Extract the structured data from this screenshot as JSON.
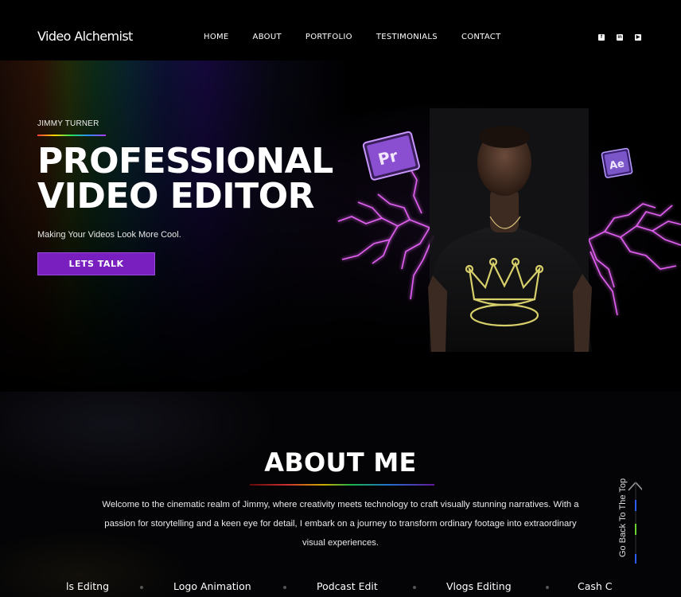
{
  "header": {
    "logo": "Video Alchemist",
    "nav": [
      "HOME",
      "ABOUT",
      "PORTFOLIO",
      "TESTIMONIALS",
      "CONTACT"
    ],
    "socials": [
      {
        "icon": "facebook-icon",
        "glyph": "f"
      },
      {
        "icon": "linkedin-icon",
        "glyph": "in"
      },
      {
        "icon": "youtube-icon",
        "glyph": "▶"
      }
    ]
  },
  "hero": {
    "kicker": "JIMMY TURNER",
    "title": "PROFESSIONAL\nVIDEO EDITOR",
    "tagline": "Making Your Videos Look More Cool.",
    "cta": "LETS TALK",
    "badge_left": "Pr",
    "badge_right": "Ae"
  },
  "about": {
    "title": "ABOUT ME",
    "text": "Welcome to the cinematic realm of Jimmy, where creativity meets technology to craft visually stunning narratives. With a passion for storytelling and a keen eye for detail, I embark on a journey to transform ordinary footage into extraordinary visual experiences.",
    "services": [
      "ls Editng",
      "Logo Animation",
      "Podcast Edit",
      "Vlogs Editing",
      "Cash C"
    ]
  },
  "back_to_top": "Go Back To The Top",
  "colors": {
    "accent": "#7a1fbf",
    "lightning": "#e24bff"
  }
}
